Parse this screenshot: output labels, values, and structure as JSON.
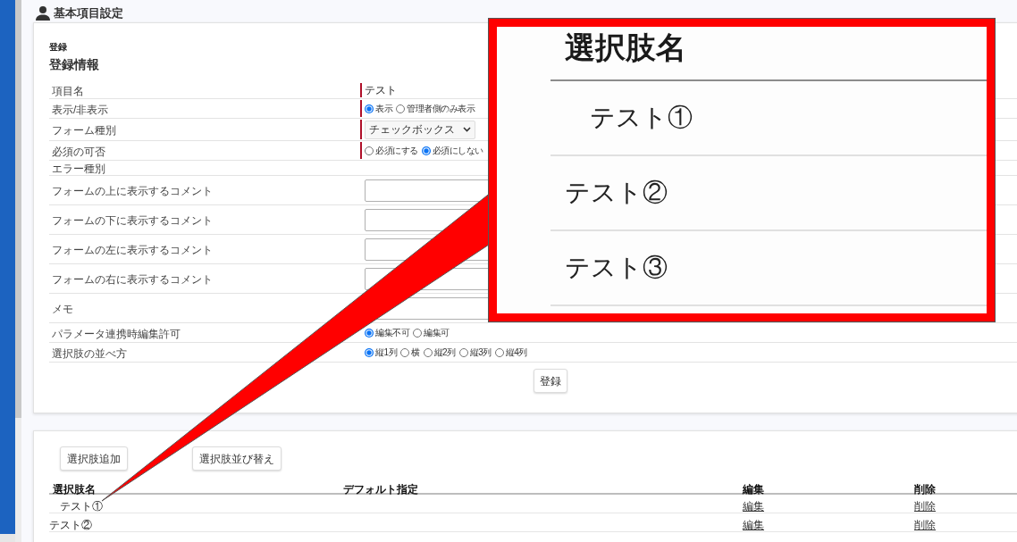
{
  "page_title": "基本項目設定",
  "form_card": {
    "section_label": "登録",
    "heading": "登録情報",
    "rows": [
      {
        "label": "項目名",
        "kind": "text",
        "required": true,
        "value": "テスト"
      },
      {
        "label": "表示/非表示",
        "kind": "radio",
        "required": true,
        "options": [
          {
            "label": "表示",
            "selected": true
          },
          {
            "label": "管理者側のみ表示",
            "selected": false
          }
        ]
      },
      {
        "label": "フォーム種別",
        "kind": "select",
        "required": true,
        "value": "チェックボックス"
      },
      {
        "label": "必須の可否",
        "kind": "radio",
        "required": true,
        "options": [
          {
            "label": "必須にする",
            "selected": false
          },
          {
            "label": "必須にしない",
            "selected": true
          }
        ]
      },
      {
        "label": "エラー種別",
        "kind": "none",
        "required": false
      },
      {
        "label": "フォームの上に表示するコメント",
        "kind": "textarea",
        "required": false
      },
      {
        "label": "フォームの下に表示するコメント",
        "kind": "textarea",
        "required": false
      },
      {
        "label": "フォームの左に表示するコメント",
        "kind": "textarea",
        "required": false
      },
      {
        "label": "フォームの右に表示するコメント",
        "kind": "textarea",
        "required": false
      },
      {
        "label": "メモ",
        "kind": "textarea"
      },
      {
        "label": "パラメータ連携時編集許可",
        "kind": "radio",
        "required": false,
        "options": [
          {
            "label": "編集不可",
            "selected": true
          },
          {
            "label": "編集可",
            "selected": false
          }
        ]
      },
      {
        "label": "選択肢の並べ方",
        "kind": "radio",
        "required": false,
        "options": [
          {
            "label": "縦1列",
            "selected": true
          },
          {
            "label": "横",
            "selected": false
          },
          {
            "label": "縦2列",
            "selected": false
          },
          {
            "label": "縦3列",
            "selected": false
          },
          {
            "label": "縦4列",
            "selected": false
          }
        ]
      }
    ],
    "submit_button": "登録"
  },
  "choices_card": {
    "buttons": [
      "選択肢追加",
      "選択肢並び替え"
    ],
    "table": {
      "columns": [
        "選択肢名",
        "デフォルト指定",
        "編集",
        "削除"
      ],
      "rows": [
        {
          "name": "　テスト①",
          "edit": "編集",
          "delete": "削除"
        },
        {
          "name": "テスト②",
          "edit": "編集",
          "delete": "削除"
        }
      ]
    }
  },
  "callout": {
    "header": "選択肢名",
    "rows": [
      "　テスト①",
      "テスト②",
      "テスト③"
    ]
  }
}
